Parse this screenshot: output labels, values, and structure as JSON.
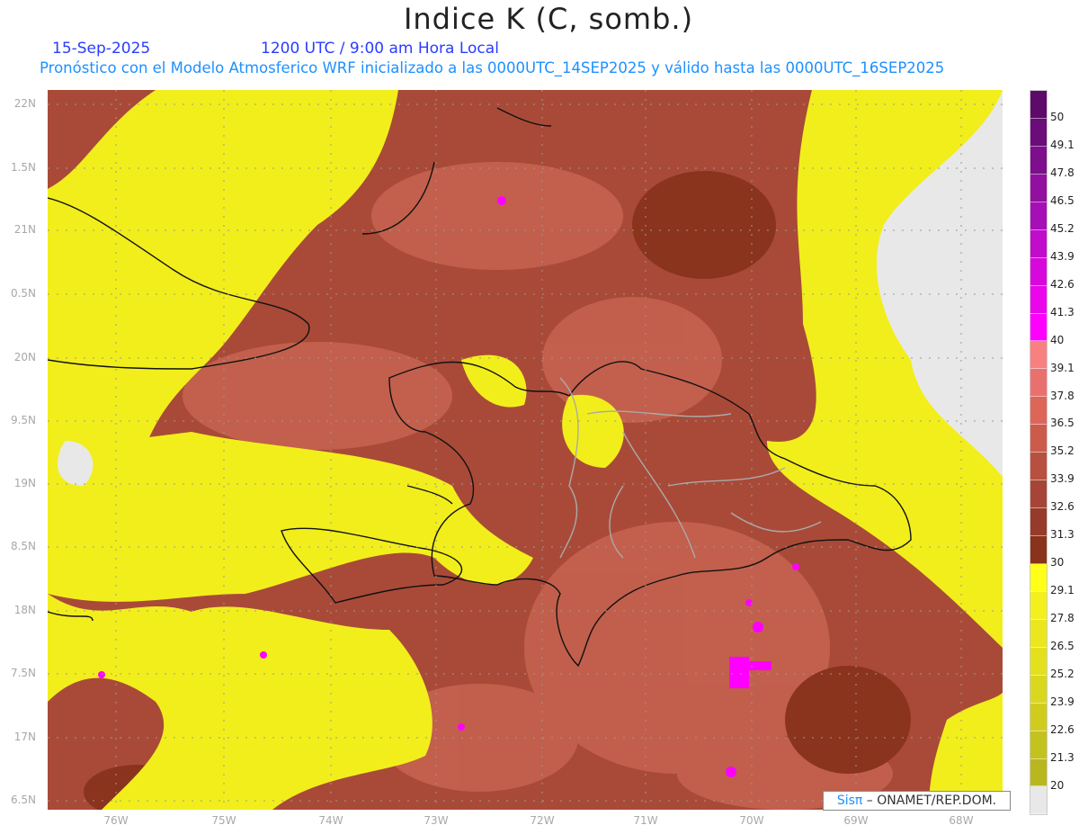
{
  "header": {
    "title": "Indice K (C, somb.)",
    "date": "15-Sep-2025",
    "time": "1200 UTC / 9:00 am Hora Local",
    "subtitle": "Pronóstico con el Modelo Atmosferico WRF inicializado a las 0000UTC_14SEP2025 y válido hasta las  0000UTC_16SEP2025"
  },
  "axes": {
    "lat_labels": [
      "22N",
      "1.5N",
      "21N",
      "0.5N",
      "20N",
      "9.5N",
      "19N",
      "8.5N",
      "18N",
      "7.5N",
      "17N",
      "6.5N"
    ],
    "lon_labels": [
      "76W",
      "75W",
      "74W",
      "73W",
      "72W",
      "71W",
      "70W",
      "69W",
      "68W"
    ]
  },
  "colorbar": {
    "labels": [
      "50",
      "49.1",
      "47.8",
      "46.5",
      "45.2",
      "43.9",
      "42.6",
      "41.3",
      "40",
      "39.1",
      "37.8",
      "36.5",
      "35.2",
      "33.9",
      "32.6",
      "31.3",
      "30",
      "29.1",
      "27.8",
      "26.5",
      "25.2",
      "23.9",
      "22.6",
      "21.3",
      "20"
    ],
    "colors": [
      "#5e0a6a",
      "#6c0b7a",
      "#7d0e8c",
      "#920f9f",
      "#a60fb5",
      "#c10ccb",
      "#d708dc",
      "#ea05ea",
      "#ff00ff",
      "#f88080",
      "#ea7070",
      "#dd6659",
      "#cc5b4c",
      "#b85040",
      "#a64536",
      "#963a2c",
      "#89321c",
      "#ffff1a",
      "#f3f01e",
      "#ece61e",
      "#e3e01e",
      "#dad81e",
      "#d0cc1e",
      "#c4c21e",
      "#b9b71e",
      "#e8e8e8"
    ]
  },
  "credit": {
    "brand": "Sisπ",
    "text": " –  ONAMET/REP.DOM."
  }
}
